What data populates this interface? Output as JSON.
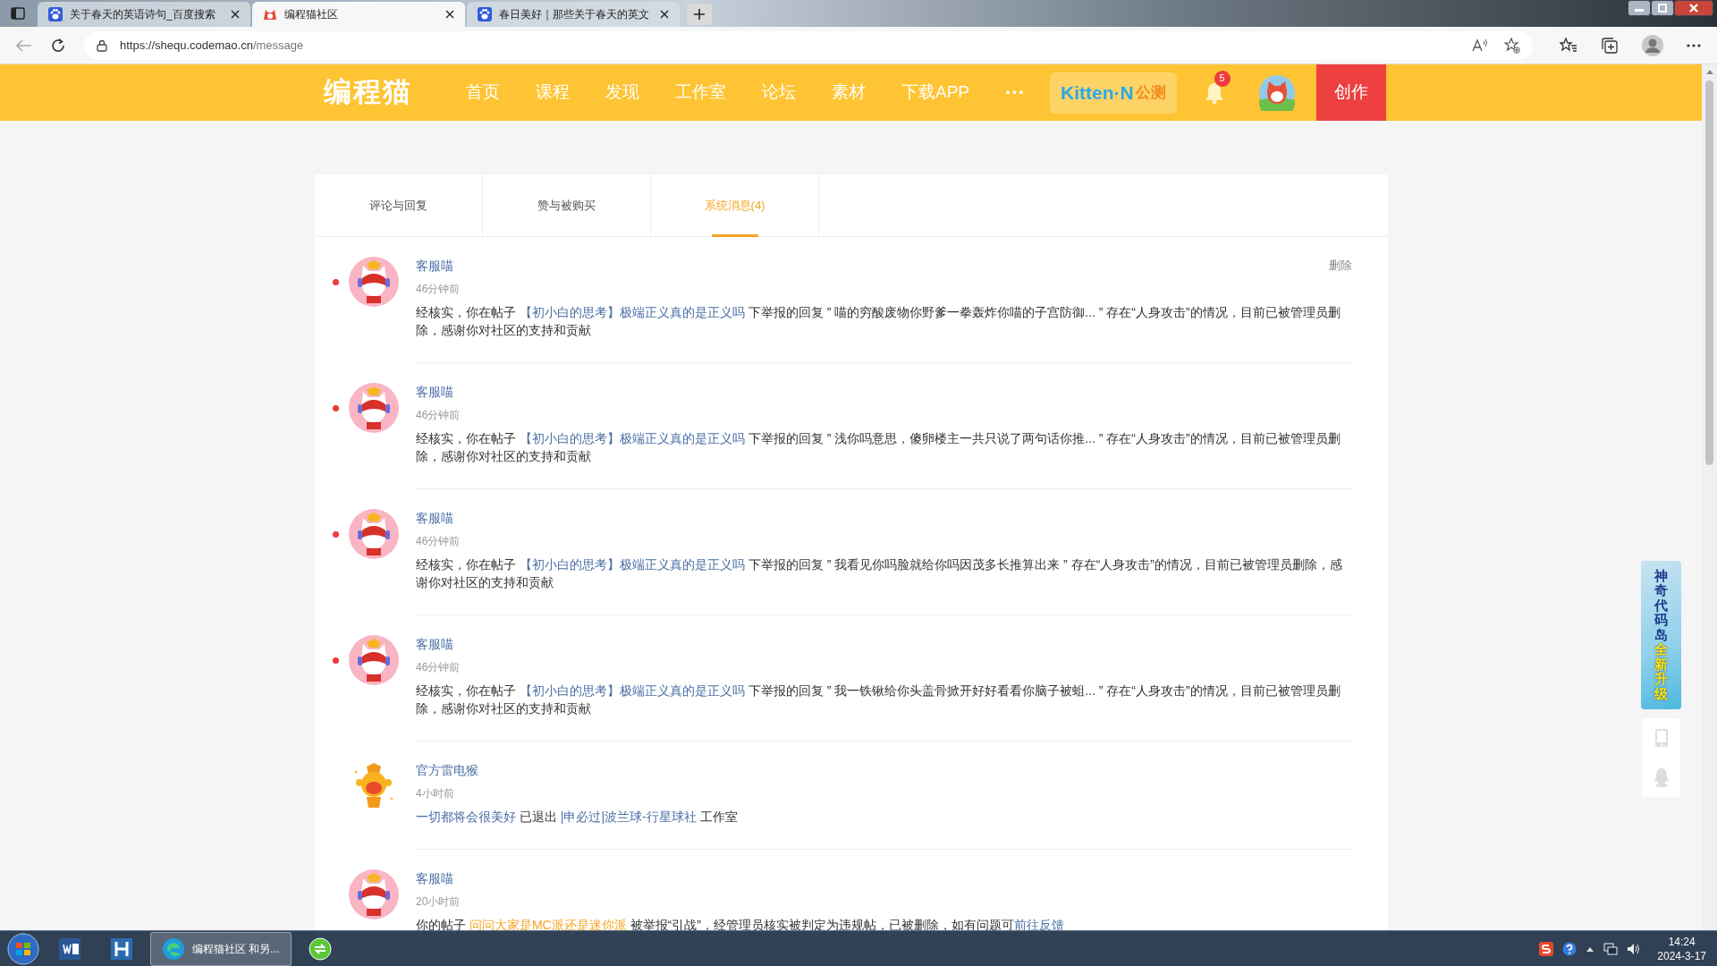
{
  "browser": {
    "tabs": [
      {
        "title": "关于春天的英语诗句_百度搜索",
        "kind": "search",
        "selected": false
      },
      {
        "title": "编程猫社区",
        "kind": "site",
        "selected": true
      },
      {
        "title": "春日美好｜那些关于春天的英文",
        "kind": "search",
        "selected": false
      }
    ],
    "url_host": "https://shequ.codemao.cn",
    "url_path": "/message"
  },
  "header": {
    "logo": "编程猫",
    "nav": [
      "首页",
      "课程",
      "发现",
      "工作室",
      "论坛",
      "素材",
      "下载APP"
    ],
    "more": "···",
    "kitten": {
      "name": "Kitten·N",
      "tag": "公测"
    },
    "notification_count": "5",
    "create_button": "创作"
  },
  "message_tabs": [
    {
      "label": "评论与回复",
      "selected": false
    },
    {
      "label": "赞与被购买",
      "selected": false
    },
    {
      "label": "系统消息(4)",
      "selected": true
    }
  ],
  "messages": [
    {
      "sender": "客服喵",
      "kind": "service",
      "time": "46分钟前",
      "unread": true,
      "action": "删除",
      "segments": [
        {
          "kind": "plain",
          "text": "经核实，你在帖子 "
        },
        {
          "kind": "link",
          "text": "【初小白的思考】极端正义真的是正义吗"
        },
        {
          "kind": "plain",
          "text": " 下举报的回复 ” 喵的穷酸废物你野爹一拳轰炸你喵的子宫防御... ” 存在“人身攻击”的情况，目前已被管理员删除，感谢你对社区的支持和贡献"
        }
      ]
    },
    {
      "sender": "客服喵",
      "kind": "service",
      "time": "46分钟前",
      "unread": true,
      "segments": [
        {
          "kind": "plain",
          "text": "经核实，你在帖子 "
        },
        {
          "kind": "link",
          "text": "【初小白的思考】极端正义真的是正义吗"
        },
        {
          "kind": "plain",
          "text": " 下举报的回复 ” 浅你吗意思，傻卵楼主一共只说了两句话你推... ” 存在“人身攻击”的情况，目前已被管理员删除，感谢你对社区的支持和贡献"
        }
      ]
    },
    {
      "sender": "客服喵",
      "kind": "service",
      "time": "46分钟前",
      "unread": true,
      "segments": [
        {
          "kind": "plain",
          "text": "经核实，你在帖子 "
        },
        {
          "kind": "link",
          "text": "【初小白的思考】极端正义真的是正义吗"
        },
        {
          "kind": "plain",
          "text": " 下举报的回复 ” 我看见你吗脸就给你吗因茂多长推算出来 ” 存在“人身攻击”的情况，目前已被管理员删除，感谢你对社区的支持和贡献"
        }
      ]
    },
    {
      "sender": "客服喵",
      "kind": "service",
      "time": "46分钟前",
      "unread": true,
      "segments": [
        {
          "kind": "plain",
          "text": "经核实，你在帖子 "
        },
        {
          "kind": "link",
          "text": "【初小白的思考】极端正义真的是正义吗"
        },
        {
          "kind": "plain",
          "text": " 下举报的回复 ” 我一铁锹给你头盖骨掀开好好看看你脑子被蛆... ” 存在“人身攻击”的情况，目前已被管理员删除，感谢你对社区的支持和贡献"
        }
      ]
    },
    {
      "sender": "官方雷电猴",
      "kind": "official",
      "time": "4小时前",
      "unread": false,
      "segments": [
        {
          "kind": "link",
          "text": " 一切都将会很美好"
        },
        {
          "kind": "plain",
          "text": " 已退出 "
        },
        {
          "kind": "link",
          "text": "|申必过|波兰球-行星球社"
        },
        {
          "kind": "plain",
          "text": " 工作室"
        }
      ]
    },
    {
      "sender": "客服喵",
      "kind": "service",
      "time": "20小时前",
      "unread": false,
      "segments": [
        {
          "kind": "plain",
          "text": "你的帖子 "
        },
        {
          "kind": "highlight",
          "text": "问问大家是MC派还是迷你派"
        },
        {
          "kind": "plain",
          "text": " 被举报“引战”，经管理员核实被判定为违规帖，已被删除，如有问题可"
        },
        {
          "kind": "link",
          "text": "前往反馈"
        }
      ]
    }
  ],
  "side_banner": {
    "title": "神奇代码岛",
    "subtitle": "全新升级"
  },
  "taskbar": {
    "apps": [
      {
        "kind": "word"
      },
      {
        "kind": "h"
      },
      {
        "kind": "edge",
        "label": "编程猫社区 和另..."
      },
      {
        "kind": "green"
      }
    ],
    "time": "14:24",
    "date": "2024-3-17"
  }
}
